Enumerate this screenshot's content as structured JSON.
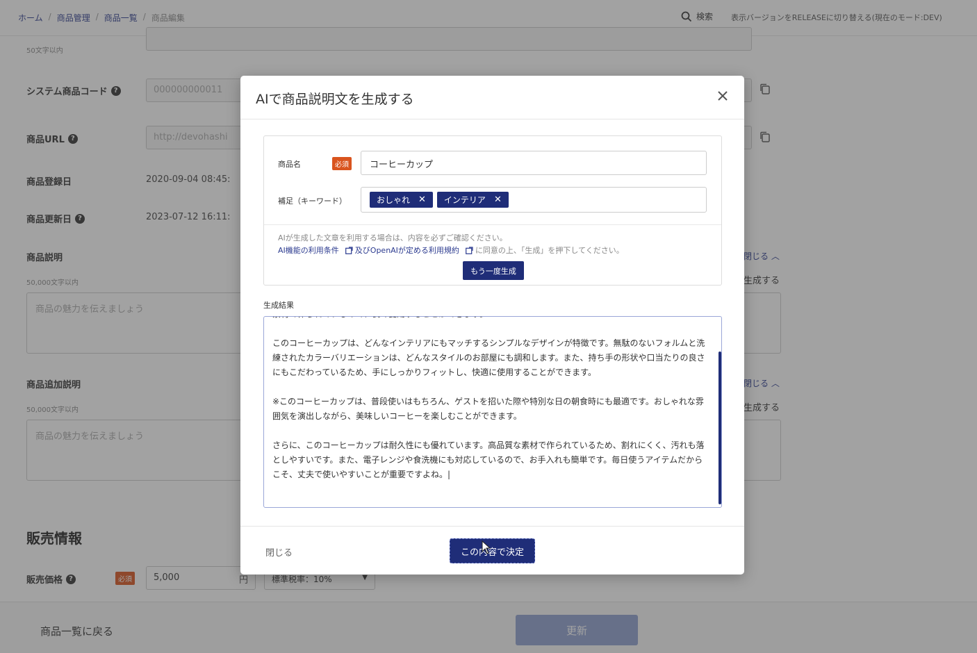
{
  "header": {
    "breadcrumb": [
      {
        "label": "ホーム"
      },
      {
        "label": "商品管理"
      },
      {
        "label": "商品一覧"
      },
      {
        "label": "商品編集"
      }
    ],
    "search_label": "検索",
    "mode_text": "表示バージョンをRELEASEに切り替える(現在のモード:DEV)"
  },
  "page": {
    "char_limit_50": "50文字以内",
    "system_code_label": "システム商品コード",
    "system_code_value": "000000000011",
    "url_label": "商品URL",
    "url_value": "http://devohashi",
    "registered_label": "商品登録日",
    "registered_value": "2020-09-04 08:45:",
    "updated_label": "商品更新日",
    "updated_value": "2023-07-12 16:11:",
    "description_label": "商品説明",
    "char_limit_50000": "50,000文字以内",
    "textarea_placeholder": "商品の魅力を伝えましょう",
    "additional_label": "商品追加説明",
    "close_link": "閉じる",
    "generate_link": "生成する",
    "sales_section": "販売情報",
    "price_label": "販売価格",
    "required": "必須",
    "price_value": "5,000",
    "price_unit": "円",
    "tax_value": "標準税率：10%",
    "back_link": "商品一覧に戻る",
    "update_button": "更新"
  },
  "modal": {
    "title": "AIで商品説明文を生成する",
    "name_label": "商品名",
    "required": "必須",
    "name_value": "コーヒーカップ",
    "keywords_label": "補足（キーワード）",
    "tags": [
      {
        "label": "おしゃれ"
      },
      {
        "label": "インテリア"
      }
    ],
    "notice_line1": "AIが生成した文章を利用する場合は、内容を必ずご確認ください。",
    "notice_link1": "AI機能の利用条件",
    "notice_mid": "及びOpenAIが定める利用規約",
    "notice_tail": "に同意の上、「生成」を押下してください。",
    "regenerate_button": "もう一度生成",
    "result_label": "生成結果",
    "result_paragraphs": [
      "素材で作られているので、長く愛用することができます。",
      "このコーヒーカップは、どんなインテリアにもマッチするシンプルなデザインが特徴です。無駄のないフォルムと洗練されたカラーバリエーションは、どんなスタイルのお部屋にも調和します。また、持ち手の形状や口当たりの良さにもこだわっているため、手にしっかりフィットし、快適に使用することができます。",
      "※このコーヒーカップは、普段使いはもちろん、ゲストを招いた際や特別な日の朝食時にも最適です。おしゃれな雰囲気を演出しながら、美味しいコーヒーを楽しむことができます。",
      "さらに、このコーヒーカップは耐久性にも優れています。高品質な素材で作られているため、割れにくく、汚れも落としやすいです。また、電子レンジや食洗機にも対応しているので、お手入れも簡単です。毎日使うアイテムだからこそ、丈夫で使いやすいことが重要ですよね。|"
    ],
    "close_link": "閉じる",
    "confirm_button": "この内容で決定"
  },
  "colors": {
    "primary": "#1f2d78",
    "required_badge": "#d9541e",
    "link": "#2b3a8f"
  }
}
